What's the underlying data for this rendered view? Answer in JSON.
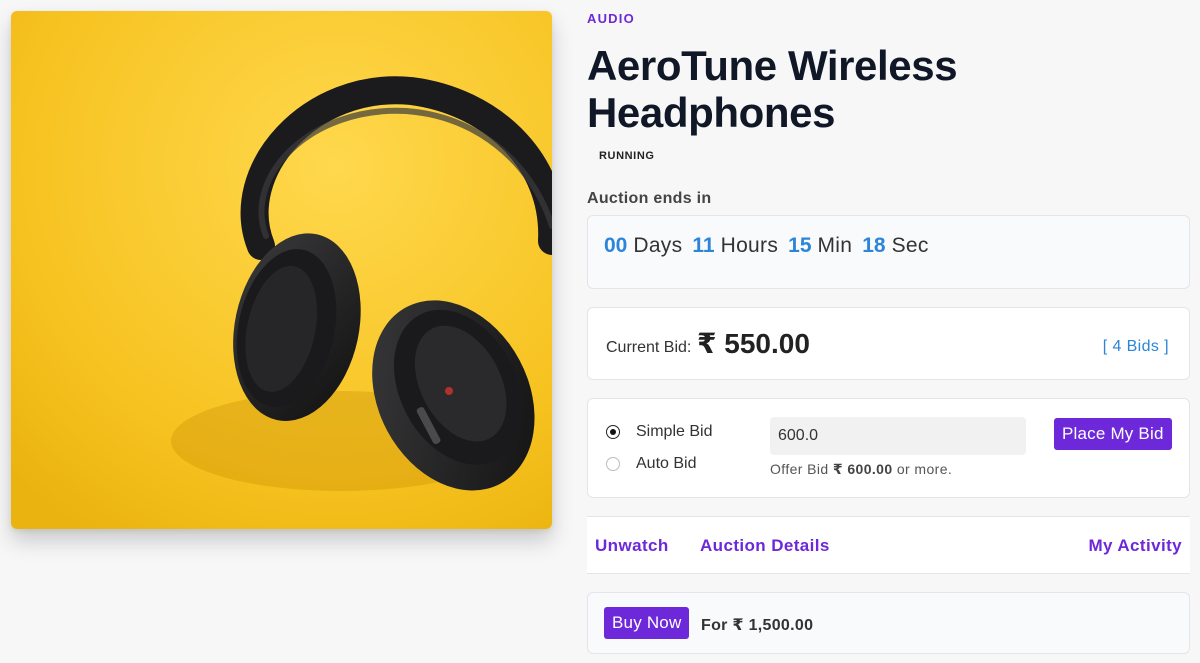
{
  "colors": {
    "accent_purple": "#6d28d9",
    "countdown_blue": "#2b86d9",
    "link_blue": "#2b86d9",
    "image_background": "#f6c21f"
  },
  "product": {
    "image_alt": "black headphones on yellow background",
    "category": "AUDIO",
    "title": "AeroTune Wireless Headphones",
    "status": "RUNNING"
  },
  "auction": {
    "ends_label": "Auction ends in",
    "countdown": [
      {
        "value": "00",
        "unit": "Days"
      },
      {
        "value": "11",
        "unit": "Hours"
      },
      {
        "value": "15",
        "unit": "Min"
      },
      {
        "value": "18",
        "unit": "Sec"
      }
    ]
  },
  "current_bid": {
    "label": "Current Bid:",
    "value": "₹ 550.00",
    "bids_link": "[ 4 Bids ]"
  },
  "bid_form": {
    "options": [
      {
        "label": "Simple Bid",
        "checked": true
      },
      {
        "label": "Auto Bid",
        "checked": false
      }
    ],
    "input_value": "600.0",
    "hint_prefix": "Offer Bid",
    "hint_amount": "₹ 600.00",
    "hint_suffix": "or more.",
    "submit_label": "Place My Bid"
  },
  "links": {
    "unwatch": "Unwatch",
    "auction_details": "Auction Details",
    "my_activity": "My Activity"
  },
  "buy_now": {
    "button_label": "Buy Now",
    "price_text": "For ₹ 1,500.00"
  }
}
